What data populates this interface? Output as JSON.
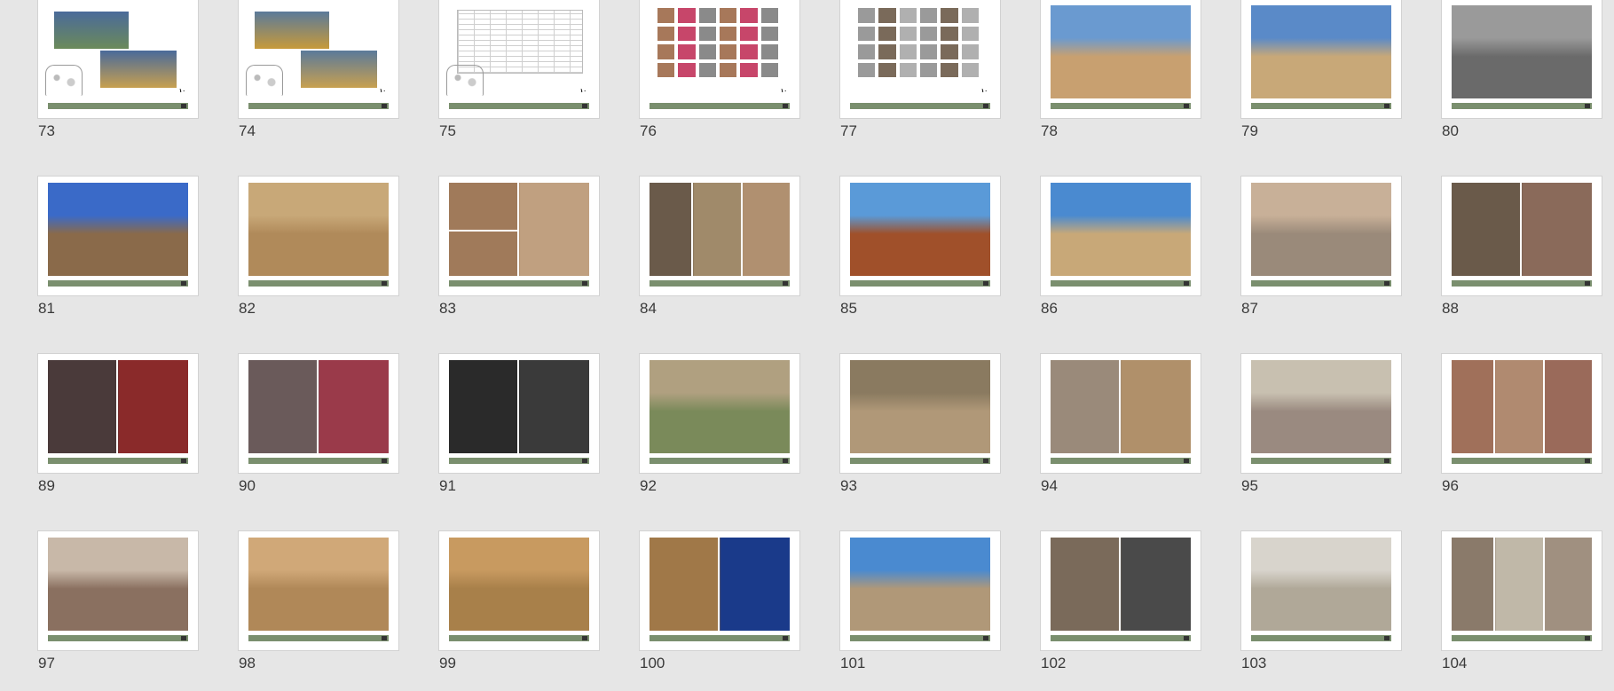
{
  "slides": [
    {
      "number": "73",
      "layout": "two-photo-sketch",
      "colors": [
        "#6b8a5a",
        "#4a6a9a"
      ],
      "ref": "۱۰"
    },
    {
      "number": "74",
      "layout": "two-photo-sketch",
      "colors": [
        "#c79a3a",
        "#5b7a9a"
      ],
      "ref": "۱۰"
    },
    {
      "number": "75",
      "layout": "document-table",
      "colors": [
        "#ffffff"
      ],
      "ref": "۱۰"
    },
    {
      "number": "76",
      "layout": "tile-collage",
      "colors": [
        "#a7785a",
        "#c7466a",
        "#8a8a8a"
      ],
      "ref": "۱۰"
    },
    {
      "number": "77",
      "layout": "tile-collage",
      "colors": [
        "#9a9a9a",
        "#7a6a5a",
        "#b0b0b0"
      ],
      "ref": "۱۰"
    },
    {
      "number": "78",
      "layout": "single-photo",
      "colors": [
        "#c8a070",
        "#6a9ad0"
      ]
    },
    {
      "number": "79",
      "layout": "single-photo",
      "colors": [
        "#c8a878",
        "#5a8ac8"
      ]
    },
    {
      "number": "80",
      "layout": "single-photo",
      "colors": [
        "#6a6a6a",
        "#9a9a9a"
      ]
    },
    {
      "number": "81",
      "layout": "single-photo",
      "colors": [
        "#8a6a4a",
        "#3a6ac8"
      ]
    },
    {
      "number": "82",
      "layout": "single-photo",
      "colors": [
        "#b08a5a",
        "#c8a878"
      ]
    },
    {
      "number": "83",
      "layout": "three-photo",
      "colors": [
        "#a07a5a",
        "#8a8a8a",
        "#c0a080"
      ]
    },
    {
      "number": "84",
      "layout": "four-photo",
      "colors": [
        "#6a5a4a",
        "#a08a6a",
        "#b09070"
      ]
    },
    {
      "number": "85",
      "layout": "single-photo",
      "colors": [
        "#a0502a",
        "#5a9ad8"
      ]
    },
    {
      "number": "86",
      "layout": "single-photo",
      "colors": [
        "#c8a878",
        "#4a8ad0"
      ]
    },
    {
      "number": "87",
      "layout": "single-photo",
      "colors": [
        "#9a8a7a",
        "#c8b098"
      ]
    },
    {
      "number": "88",
      "layout": "two-photo",
      "colors": [
        "#6a5a4a",
        "#8a6a5a"
      ]
    },
    {
      "number": "89",
      "layout": "two-photo",
      "colors": [
        "#4a3a3a",
        "#8a2a2a"
      ]
    },
    {
      "number": "90",
      "layout": "two-photo",
      "colors": [
        "#6a5a5a",
        "#9a3a4a"
      ]
    },
    {
      "number": "91",
      "layout": "two-photo",
      "colors": [
        "#2a2a2a",
        "#3a3a3a"
      ]
    },
    {
      "number": "92",
      "layout": "single-photo",
      "colors": [
        "#7a8a5a",
        "#b0a080"
      ]
    },
    {
      "number": "93",
      "layout": "single-photo",
      "colors": [
        "#b09878",
        "#8a7a60"
      ]
    },
    {
      "number": "94",
      "layout": "two-photo",
      "colors": [
        "#9a8a7a",
        "#b0906a"
      ]
    },
    {
      "number": "95",
      "layout": "single-photo",
      "colors": [
        "#9a8a80",
        "#c8c0b0"
      ]
    },
    {
      "number": "96",
      "layout": "four-photo",
      "colors": [
        "#a0705a",
        "#b08a70",
        "#9a6a5a"
      ]
    },
    {
      "number": "97",
      "layout": "single-photo",
      "colors": [
        "#8a7060",
        "#c8b8a8"
      ]
    },
    {
      "number": "98",
      "layout": "single-photo",
      "colors": [
        "#b08858",
        "#d0a878"
      ]
    },
    {
      "number": "99",
      "layout": "single-photo",
      "colors": [
        "#a8804a",
        "#c89a60"
      ]
    },
    {
      "number": "100",
      "layout": "two-photo",
      "colors": [
        "#a07848",
        "#1a3a8a"
      ]
    },
    {
      "number": "101",
      "layout": "single-photo",
      "colors": [
        "#b09878",
        "#4a8ad0"
      ]
    },
    {
      "number": "102",
      "layout": "two-photo",
      "colors": [
        "#7a6a5a",
        "#4a4a4a"
      ]
    },
    {
      "number": "103",
      "layout": "single-photo",
      "colors": [
        "#b0a898",
        "#d8d4cc"
      ]
    },
    {
      "number": "104",
      "layout": "four-photo",
      "colors": [
        "#8a7a6a",
        "#c0b8a8",
        "#a09080"
      ]
    }
  ]
}
